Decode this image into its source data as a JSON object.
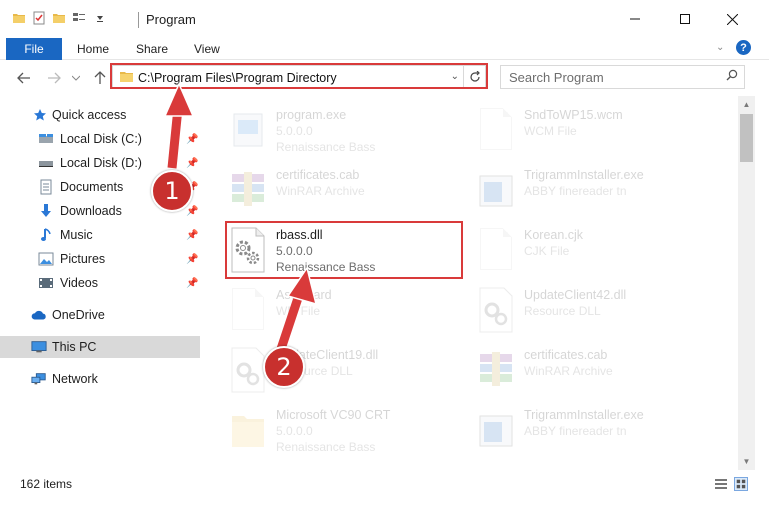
{
  "window": {
    "title": "Program"
  },
  "ribbon": {
    "file_label": "File",
    "tabs": [
      "Home",
      "Share",
      "View"
    ]
  },
  "address": {
    "path": "C:\\Program Files\\Program Directory"
  },
  "search": {
    "placeholder": "Search Program"
  },
  "sidebar": {
    "items": [
      {
        "label": "Quick access",
        "icon": "star-icon"
      },
      {
        "label": "Local Disk (C:)",
        "icon": "drive-icon"
      },
      {
        "label": "Local Disk (D:)",
        "icon": "drive-icon"
      },
      {
        "label": "Documents",
        "icon": "documents-icon"
      },
      {
        "label": "Downloads",
        "icon": "download-icon"
      },
      {
        "label": "Music",
        "icon": "music-icon"
      },
      {
        "label": "Pictures",
        "icon": "pictures-icon"
      },
      {
        "label": "Videos",
        "icon": "videos-icon"
      },
      {
        "label": "OneDrive",
        "icon": "cloud-icon"
      },
      {
        "label": "This PC",
        "icon": "computer-icon"
      },
      {
        "label": "Network",
        "icon": "network-icon"
      }
    ]
  },
  "files": {
    "left": [
      {
        "name": "program.exe",
        "desc": "5.0.0.0",
        "sub": "Renaissance Bass",
        "icon": "exe-icon"
      },
      {
        "name": "certificates.cab",
        "desc": "WinRAR Archive",
        "sub": "",
        "icon": "winrar-icon"
      },
      {
        "name": "rbass.dll",
        "desc": "5.0.0.0",
        "sub": "Renaissance Bass",
        "icon": "dll-gear-icon"
      },
      {
        "name": "Asoftward",
        "desc": "WM File",
        "sub": "",
        "icon": "blank-file-icon"
      },
      {
        "name": "UpdateClient19.dll",
        "desc": "Resource DLL",
        "sub": "",
        "icon": "dll-gear-icon"
      },
      {
        "name": "Microsoft VC90 CRT",
        "desc": "5.0.0.0",
        "sub": "Renaissance Bass",
        "icon": "folder-icon"
      }
    ],
    "right": [
      {
        "name": "SndToWP15.wcm",
        "desc": "WCM File",
        "sub": "",
        "icon": "blank-file-icon"
      },
      {
        "name": "TrigrammInstaller.exe",
        "desc": "ABBY finereader tn",
        "sub": "",
        "icon": "installer-icon"
      },
      {
        "name": "Korean.cjk",
        "desc": "CJK File",
        "sub": "",
        "icon": "blank-file-icon"
      },
      {
        "name": "UpdateClient42.dll",
        "desc": "Resource DLL",
        "sub": "",
        "icon": "dll-gear-icon"
      },
      {
        "name": "certificates.cab",
        "desc": "WinRAR Archive",
        "sub": "",
        "icon": "winrar-icon"
      },
      {
        "name": "TrigrammInstaller.exe",
        "desc": "ABBY finereader tn",
        "sub": "",
        "icon": "installer-icon"
      }
    ]
  },
  "status": {
    "item_count": "162 items"
  },
  "annotations": {
    "step1": "1",
    "step2": "2",
    "color": "#d93a3a"
  },
  "colors": {
    "accent": "#1a67c2",
    "highlight_box": "#d93a3a",
    "selected_nav": "#d9d9d9"
  }
}
